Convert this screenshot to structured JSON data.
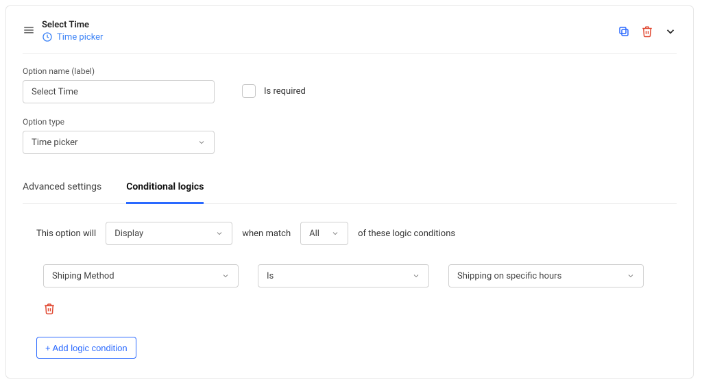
{
  "header": {
    "title": "Select Time",
    "subtitle": "Time picker"
  },
  "fields": {
    "option_name_label": "Option name (label)",
    "option_name_value": "Select Time",
    "is_required_label": "Is required",
    "option_type_label": "Option type",
    "option_type_value": "Time picker"
  },
  "tabs": {
    "advanced": "Advanced settings",
    "conditional": "Conditional logics"
  },
  "sentence": {
    "pre": "This option will",
    "action_value": "Display",
    "mid": "when match",
    "match_value": "All",
    "post": "of these logic conditions"
  },
  "condition": {
    "subject": "Shiping Method",
    "op": "Is",
    "value": "Shipping on specific hours"
  },
  "add_button": "+ Add logic condition"
}
